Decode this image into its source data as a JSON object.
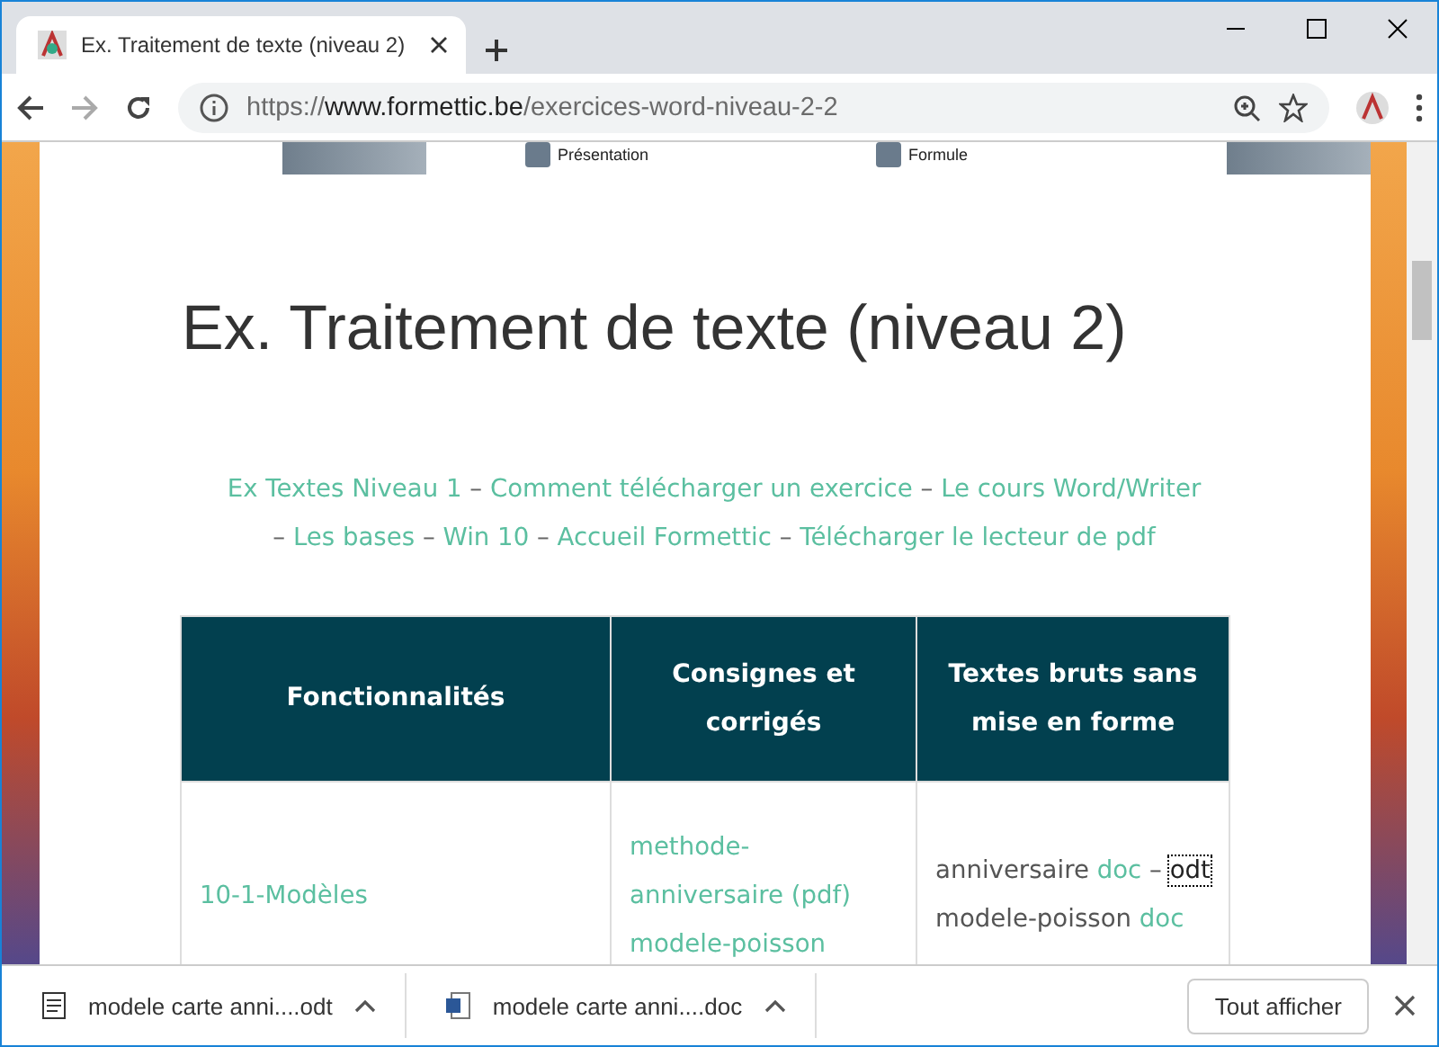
{
  "tab": {
    "title": "Ex. Traitement de texte (niveau 2)",
    "selected": true
  },
  "address": {
    "parts": [
      {
        "kind": "dim",
        "text": "https://"
      },
      {
        "kind": "host",
        "text": "www.formettic.be"
      },
      {
        "kind": "dim",
        "text": "/exercices-word-niveau-2-2"
      }
    ]
  },
  "image_strip": {
    "items": [
      "Présentation",
      "Formule"
    ]
  },
  "page": {
    "title": "Ex. Traitement de texte (niveau 2)",
    "nav": [
      {
        "kind": "link",
        "text": "Ex Textes Niveau 1"
      },
      {
        "kind": "sep",
        "text": "–"
      },
      {
        "kind": "link",
        "text": "Comment télécharger un exercice"
      },
      {
        "kind": "sep",
        "text": "–"
      },
      {
        "kind": "link",
        "text": "Le cours Word/Writer"
      },
      {
        "kind": "sep",
        "text": "–"
      },
      {
        "kind": "link",
        "text": "Les bases"
      },
      {
        "kind": "sep",
        "text": "–"
      },
      {
        "kind": "link",
        "text": "Win 10"
      },
      {
        "kind": "sep",
        "text": "–"
      },
      {
        "kind": "link",
        "text": "Accueil Formettic"
      },
      {
        "kind": "sep",
        "text": "–"
      },
      {
        "kind": "link",
        "text": "Télécharger le lecteur de pdf"
      }
    ],
    "table": {
      "columns": [
        "Fonctionnalités",
        "Consignes et corrigés",
        "Textes bruts sans mise en forme"
      ],
      "rows": [
        [
          [
            {
              "kind": "link",
              "text": "10-1-Modèles",
              "focused": false
            }
          ],
          [
            {
              "kind": "block_link",
              "text": "methode-anniversaire (pdf)",
              "focused": false
            },
            {
              "kind": "block_link",
              "text": "modele-poisson",
              "focused": false
            }
          ],
          [
            {
              "kind": "text",
              "text": "anniversaire",
              "focused": false
            },
            {
              "kind": "link",
              "text": "doc",
              "focused": false
            },
            {
              "kind": "text",
              "text": "–",
              "focused": false
            },
            {
              "kind": "text",
              "text": "odt",
              "focused": true
            },
            {
              "kind": "break",
              "text": ""
            },
            {
              "kind": "text",
              "text": "modele-poisson",
              "focused": false
            },
            {
              "kind": "link",
              "text": "doc",
              "focused": false
            }
          ]
        ]
      ]
    }
  },
  "downloads": {
    "items": [
      {
        "name": "modele carte anni....odt",
        "kind": "odt"
      },
      {
        "name": "modele carte anni....doc",
        "kind": "doc"
      }
    ],
    "show_all": "Tout afficher"
  }
}
